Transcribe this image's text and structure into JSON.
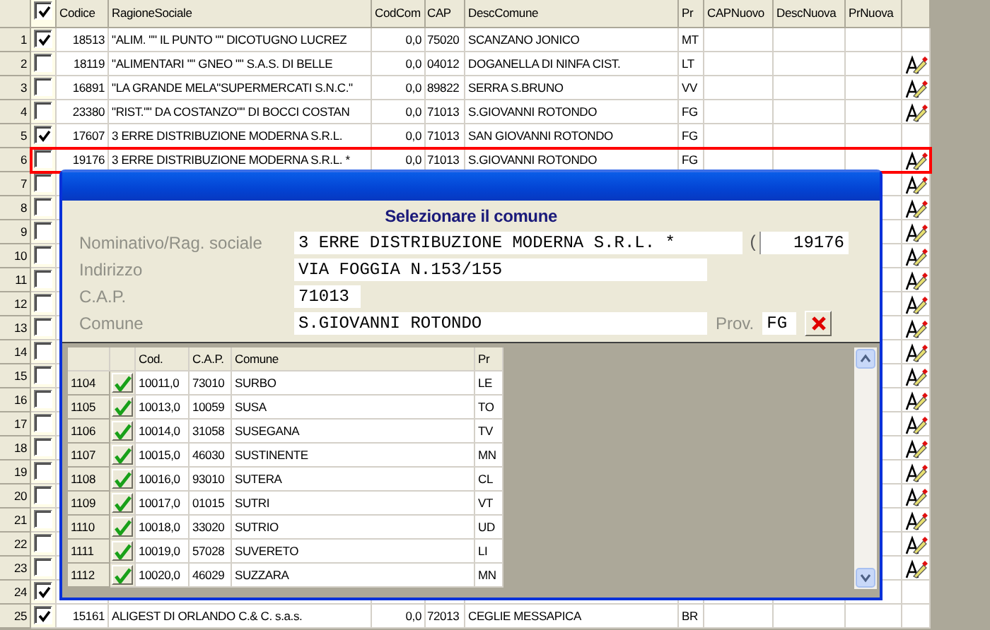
{
  "grid": {
    "header_checkbox": {
      "checked": true
    },
    "columns": [
      "Codice",
      "RagioneSociale",
      "CodCom",
      "CAP",
      "DescComune",
      "Pr",
      "CAPNuovo",
      "DescNuova",
      "PrNuova"
    ],
    "rows": [
      {
        "number": "1",
        "checked": true,
        "selected": false,
        "edit_icon": false,
        "cells": [
          "18513",
          "\"ALIM. \"\" IL PUNTO \"\" DICOTUGNO LUCREZ",
          "0,0",
          "75020",
          "SCANZANO JONICO",
          "MT"
        ]
      },
      {
        "number": "2",
        "checked": false,
        "selected": false,
        "edit_icon": true,
        "cells": [
          "18119",
          "\"ALIMENTARI \"\" GNEO \"\" S.A.S. DI BELLE",
          "0,0",
          "04012",
          "DOGANELLA DI NINFA CIST.",
          "LT"
        ]
      },
      {
        "number": "3",
        "checked": false,
        "selected": false,
        "edit_icon": true,
        "cells": [
          "16891",
          "\"LA GRANDE MELA\"SUPERMERCATI S.N.C.\"",
          "0,0",
          "89822",
          "SERRA S.BRUNO",
          "VV"
        ]
      },
      {
        "number": "4",
        "checked": false,
        "selected": false,
        "edit_icon": true,
        "cells": [
          "23380",
          "\"RIST.\"\" DA COSTANZO\"\" DI BOCCI COSTAN",
          "0,0",
          "71013",
          "S.GIOVANNI ROTONDO",
          "FG"
        ]
      },
      {
        "number": "5",
        "checked": true,
        "selected": false,
        "edit_icon": false,
        "cells": [
          "17607",
          "3 ERRE DISTRIBUZIONE MODERNA S.R.L.",
          "0,0",
          "71013",
          "SAN GIOVANNI ROTONDO",
          "FG"
        ]
      },
      {
        "number": "6",
        "checked": false,
        "selected": true,
        "edit_icon": true,
        "cells": [
          "19176",
          "3 ERRE DISTRIBUZIONE MODERNA S.R.L. *",
          "0,0",
          "71013",
          "S.GIOVANNI ROTONDO",
          "FG"
        ]
      },
      {
        "number": "7",
        "checked": false,
        "selected": false,
        "edit_icon": true
      },
      {
        "number": "8",
        "checked": false,
        "selected": false,
        "edit_icon": true
      },
      {
        "number": "9",
        "checked": false,
        "selected": false,
        "edit_icon": true
      },
      {
        "number": "10",
        "checked": false,
        "selected": false,
        "edit_icon": true
      },
      {
        "number": "11",
        "checked": false,
        "selected": false,
        "edit_icon": true
      },
      {
        "number": "12",
        "checked": false,
        "selected": false,
        "edit_icon": true
      },
      {
        "number": "13",
        "checked": false,
        "selected": false,
        "edit_icon": true
      },
      {
        "number": "14",
        "checked": false,
        "selected": false,
        "edit_icon": true
      },
      {
        "number": "15",
        "checked": false,
        "selected": false,
        "edit_icon": true
      },
      {
        "number": "16",
        "checked": false,
        "selected": false,
        "edit_icon": true
      },
      {
        "number": "17",
        "checked": false,
        "selected": false,
        "edit_icon": true
      },
      {
        "number": "18",
        "checked": false,
        "selected": false,
        "edit_icon": true
      },
      {
        "number": "19",
        "checked": false,
        "selected": false,
        "edit_icon": true
      },
      {
        "number": "20",
        "checked": false,
        "selected": false,
        "edit_icon": true
      },
      {
        "number": "21",
        "checked": false,
        "selected": false,
        "edit_icon": true
      },
      {
        "number": "22",
        "checked": false,
        "selected": false,
        "edit_icon": true
      },
      {
        "number": "23",
        "checked": false,
        "selected": false,
        "edit_icon": true
      },
      {
        "number": "24",
        "checked": true,
        "selected": false,
        "edit_icon": false
      },
      {
        "number": "25",
        "checked": true,
        "selected": false,
        "edit_icon": false,
        "cells": [
          "15161",
          "ALIGEST DI ORLANDO C.& C. s.a.s.",
          "0,0",
          "72013",
          "CEGLIE MESSAPICA",
          "BR"
        ]
      }
    ]
  },
  "dialog": {
    "heading": "Selezionare il comune",
    "fields": [
      {
        "label": "Nominativo/Rag. sociale",
        "value": "3 ERRE DISTRIBUZIONE MODERNA S.R.L. *",
        "extra_paren": "(",
        "extra_value": "19176"
      },
      {
        "label": "Indirizzo",
        "value": "VIA FOGGIA N.153/155"
      },
      {
        "label": "C.A.P.",
        "value": "71013"
      },
      {
        "label": "Comune",
        "value": "S.GIOVANNI ROTONDO",
        "prov_label": "Prov.",
        "prov_value": "FG"
      }
    ],
    "list": {
      "columns": [
        "Cod.",
        "C.A.P.",
        "Comune",
        "Pr"
      ],
      "rows": [
        {
          "number": "1104",
          "checked": true,
          "cells": [
            "10011,0",
            "73010",
            "SURBO",
            "LE"
          ]
        },
        {
          "number": "1105",
          "checked": true,
          "cells": [
            "10013,0",
            "10059",
            "SUSA",
            "TO"
          ]
        },
        {
          "number": "1106",
          "checked": true,
          "cells": [
            "10014,0",
            "31058",
            "SUSEGANA",
            "TV"
          ]
        },
        {
          "number": "1107",
          "checked": true,
          "cells": [
            "10015,0",
            "46030",
            "SUSTINENTE",
            "MN"
          ]
        },
        {
          "number": "1108",
          "checked": true,
          "cells": [
            "10016,0",
            "93010",
            "SUTERA",
            "CL"
          ]
        },
        {
          "number": "1109",
          "checked": true,
          "cells": [
            "10017,0",
            "01015",
            "SUTRI",
            "VT"
          ]
        },
        {
          "number": "1110",
          "checked": true,
          "cells": [
            "10018,0",
            "33020",
            "SUTRIO",
            "UD"
          ]
        },
        {
          "number": "1111",
          "checked": true,
          "cells": [
            "10019,0",
            "57028",
            "SUVERETO",
            "LI"
          ]
        },
        {
          "number": "1112",
          "checked": true,
          "cells": [
            "10020,0",
            "46029",
            "SUZZARA",
            "MN"
          ]
        }
      ]
    }
  }
}
